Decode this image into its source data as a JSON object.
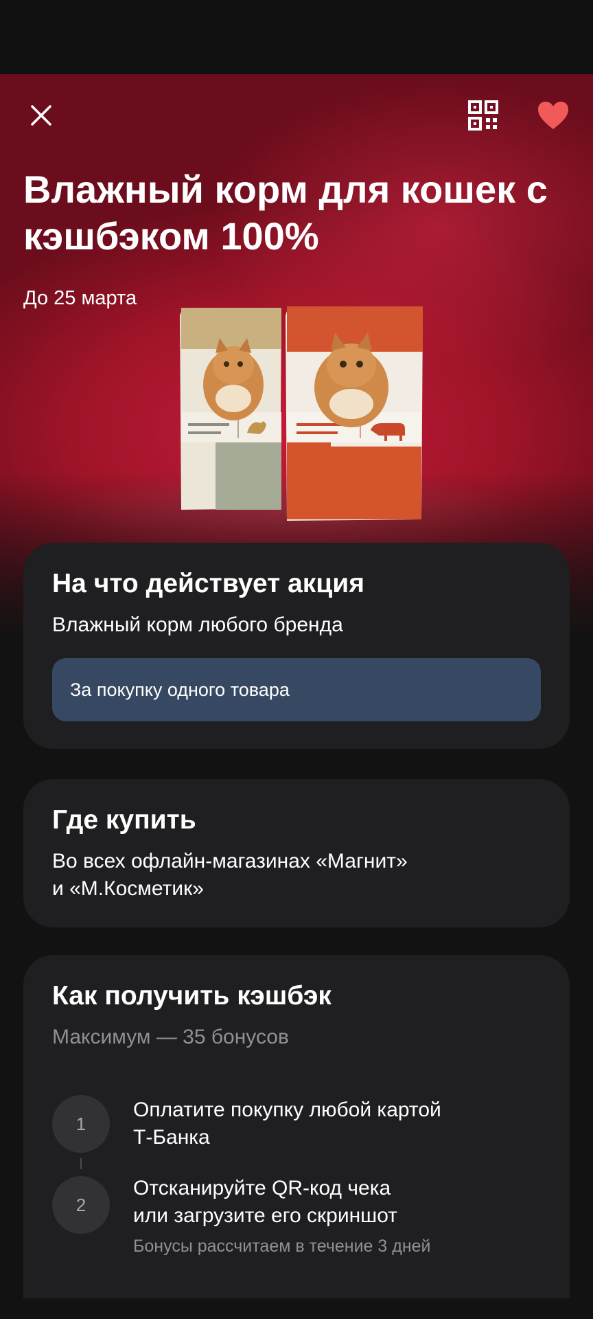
{
  "hero": {
    "title": "Влажный корм для кошек с кэшбэком 100%",
    "date": "До 25 марта",
    "icons": [
      "close-icon",
      "qr-code-icon",
      "heart-icon"
    ],
    "colors": {
      "hero_red": "#b3182f",
      "heart": "#f25a5a"
    }
  },
  "scope_card": {
    "title": "На что действует акция",
    "text": "Влажный корм любого бренда",
    "tag": "За покупку одного товара"
  },
  "where_card": {
    "title": "Где купить",
    "text_line1": "Во всех офлайн-магазинах «Магнит»",
    "text_line2": "и «М.Косметик»"
  },
  "how_card": {
    "title": "Как получить кэшбэк",
    "subtitle": "Максимум — 35 бонусов",
    "steps": [
      {
        "number": "1",
        "line1": "Оплатите покупку любой картой",
        "line2": "Т-Банка"
      },
      {
        "number": "2",
        "line1": "Отсканируйте QR-код чека",
        "line2": "или загрузите его скриншот",
        "note": "Бонусы рассчитаем в течение 3 дней"
      }
    ]
  }
}
